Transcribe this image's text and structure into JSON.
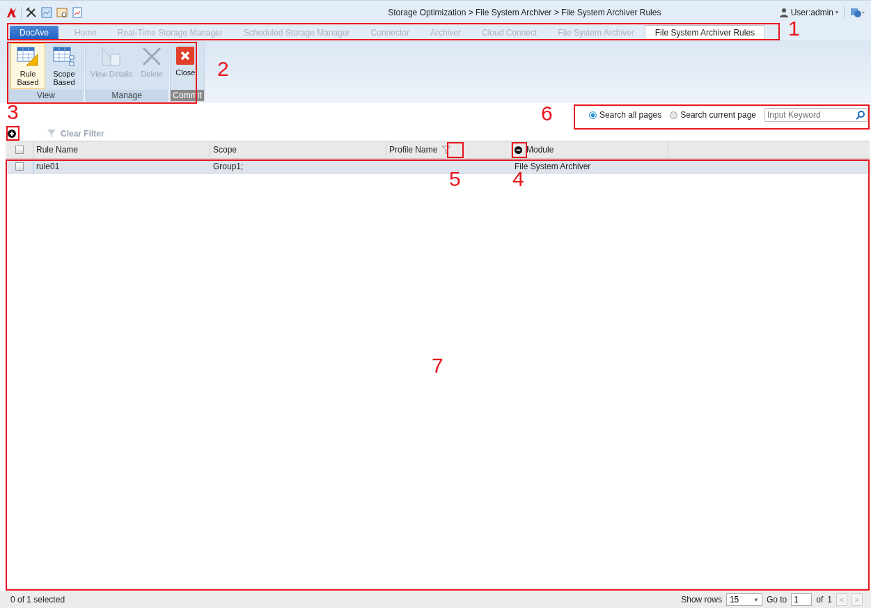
{
  "top_bar": {
    "breadcrumb": "Storage Optimization > File System Archiver > File System Archiver Rules",
    "user": "User:admin",
    "user_caret": "▾"
  },
  "tabs": [
    {
      "label": "DocAve",
      "kind": "brand",
      "selected": false
    },
    {
      "label": "Home",
      "kind": "tab",
      "selected": false
    },
    {
      "label": "Real-Time Storage Manager",
      "kind": "tab",
      "selected": false
    },
    {
      "label": "Scheduled Storage Manager",
      "kind": "tab",
      "selected": false
    },
    {
      "label": "Connector",
      "kind": "tab",
      "selected": false
    },
    {
      "label": "Archiver",
      "kind": "tab",
      "selected": false
    },
    {
      "label": "Cloud Connect",
      "kind": "tab",
      "selected": false
    },
    {
      "label": "File System Archiver",
      "kind": "tab",
      "selected": false
    },
    {
      "label": "File System Archiver Rules",
      "kind": "tab",
      "selected": true
    }
  ],
  "ribbon": [
    {
      "label": "View",
      "kind": "normal",
      "buttons": [
        {
          "label": "Rule Based",
          "selected": true,
          "disabled": false
        },
        {
          "label": "Scope Based",
          "selected": false,
          "disabled": false
        }
      ]
    },
    {
      "label": "Manage",
      "kind": "normal",
      "buttons": [
        {
          "label": "View Details",
          "selected": false,
          "disabled": true
        },
        {
          "label": "Delete",
          "selected": false,
          "disabled": true
        }
      ]
    },
    {
      "label": "Commit",
      "kind": "commit",
      "buttons": [
        {
          "label": "Close",
          "selected": false,
          "disabled": false
        }
      ]
    }
  ],
  "search": {
    "options": [
      {
        "label": "Search all pages",
        "selected": true
      },
      {
        "label": "Search current page",
        "selected": false
      }
    ],
    "placeholder": "Input Keyword"
  },
  "toolbar": {
    "clear_filter": "Clear Filter",
    "clear_filter_disabled": true
  },
  "table": {
    "header_checked": false,
    "columns": [
      {
        "label": "Rule Name",
        "kind": "plain"
      },
      {
        "label": "Scope",
        "kind": "plain"
      },
      {
        "label": "Profile Name",
        "kind": "filter"
      },
      {
        "label": "Module",
        "kind": "remove"
      }
    ],
    "rows": [
      {
        "checked": false,
        "cells": [
          "rule01",
          "Group1;",
          "",
          "File System Archiver"
        ]
      }
    ]
  },
  "status_bar": {
    "selection": "0 of 1 selected",
    "show_rows_label": "Show rows",
    "show_rows": "15",
    "show_rows_caret": "▼",
    "goto_label": "Go to",
    "page": "1",
    "of_label": "of",
    "pages": "1",
    "prev": "<",
    "next": ">"
  },
  "annotations": [
    {
      "label": "1"
    },
    {
      "label": "2"
    },
    {
      "label": "3"
    },
    {
      "label": "4"
    },
    {
      "label": "5"
    },
    {
      "label": "6"
    },
    {
      "label": "7"
    }
  ]
}
